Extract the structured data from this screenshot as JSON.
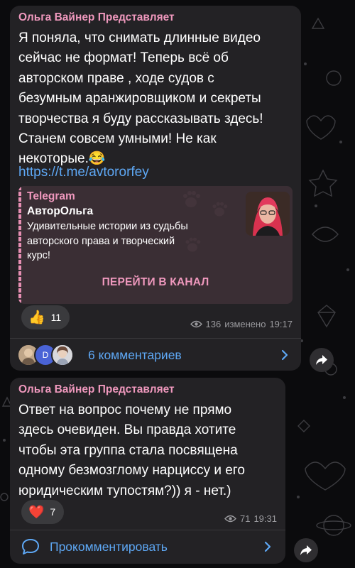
{
  "colors": {
    "author": "#ef98bd",
    "link": "#5ea8f5",
    "bubble": "#232225",
    "background": "#0b0b0d"
  },
  "post1": {
    "author": "Ольга Вайнер Представляет",
    "text": "Я поняла, что снимать длинные видео\nсейчас не формат! Теперь всё об\nавторском праве , ходе судов с\nбезумным аранжировщиком и секреты\nтворчества я буду рассказывать здесь!\nСтанем совсем умными! Не как\nнекоторые.",
    "emoji": "😂",
    "link": "https://t.me/avtororfey",
    "preview": {
      "site": "Telegram",
      "title": "АвторОльга",
      "description": "Удивительные истории из судьбы\nавторского права и творческий\nкурс!",
      "button": "ПЕРЕЙТИ В КАНАЛ",
      "thumbnail_icon": "avatar-photo"
    },
    "reaction": {
      "emoji": "👍",
      "count": "11"
    },
    "views": "136",
    "edited": "изменено",
    "time": "19:17",
    "comments": {
      "avatar_letter": "D",
      "label": "6 комментариев"
    }
  },
  "post2": {
    "author": "Ольга Вайнер Представляет",
    "text": "Ответ на вопрос почему не прямо\nздесь очевиден. Вы правда хотите\nчтобы эта группа стала посвящена\nодному безмозглому нарциссу и его\nюридическим тупостям?)) я - нет.)",
    "reaction": {
      "emoji": "❤️",
      "count": "7"
    },
    "views": "71",
    "time": "19:31",
    "comment_label": "Прокомментировать"
  }
}
